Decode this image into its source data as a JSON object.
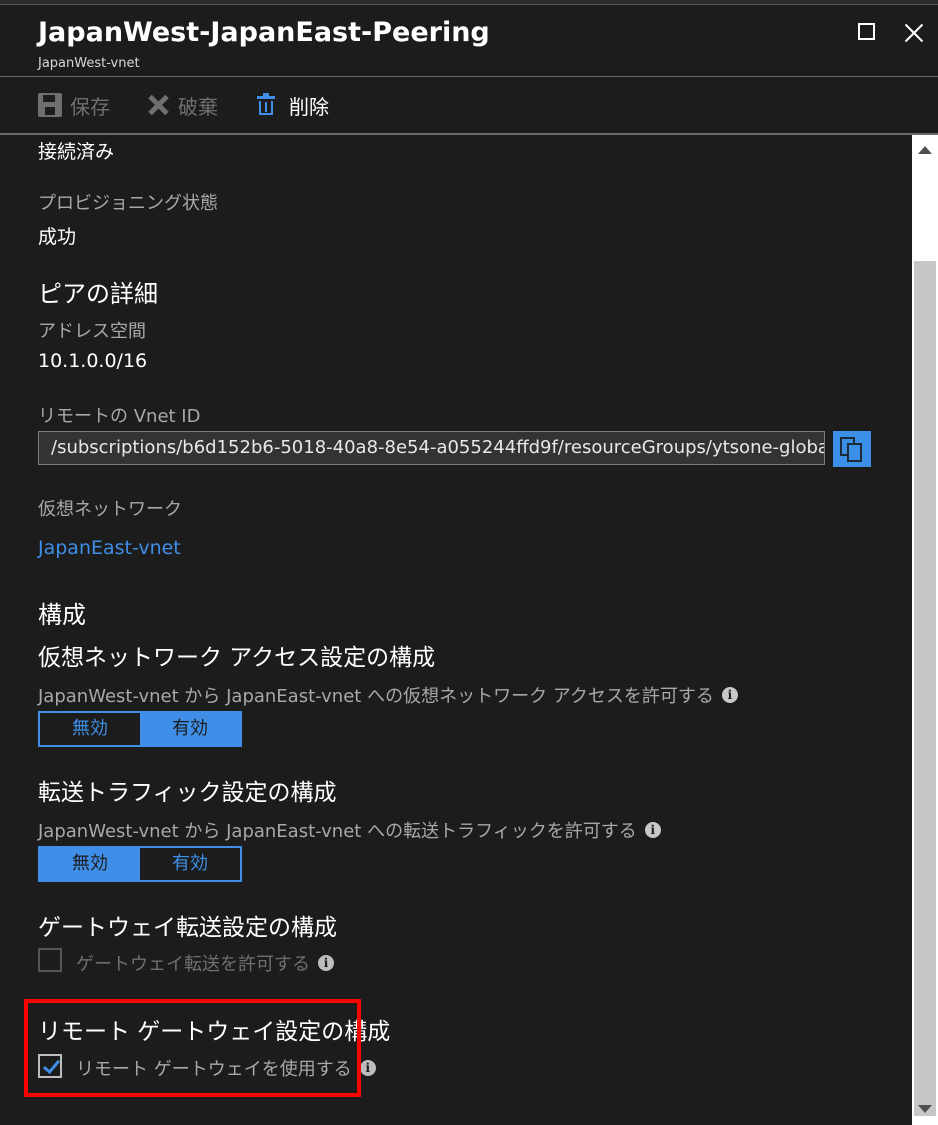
{
  "header": {
    "title": "JapanWest-JapanEast-Peering",
    "subtitle": "JapanWest-vnet"
  },
  "toolbar": {
    "save_label": "保存",
    "discard_label": "破棄",
    "delete_label": "削除"
  },
  "status": {
    "peering_value": "接続済み",
    "provisioning_label": "プロビジョニング状態",
    "provisioning_value": "成功"
  },
  "peer_details": {
    "heading": "ピアの詳細",
    "address_space_label": "アドレス空間",
    "address_space_value": "10.1.0.0/16",
    "remote_vnet_id_label": "リモートの Vnet ID",
    "remote_vnet_id_value": "/subscriptions/b6d152b6-5018-40a8-8e54-a055244ffd9f/resourceGroups/ytsone-globa...",
    "virtual_network_label": "仮想ネットワーク",
    "virtual_network_link": "JapanEast-vnet"
  },
  "configuration": {
    "heading": "構成",
    "vnet_access": {
      "heading": "仮想ネットワーク アクセス設定の構成",
      "description": "JapanWest-vnet から JapanEast-vnet への仮想ネットワーク アクセスを許可する",
      "options": [
        "無効",
        "有効"
      ],
      "selected": "有効"
    },
    "forwarded_traffic": {
      "heading": "転送トラフィック設定の構成",
      "description": "JapanWest-vnet から JapanEast-vnet への転送トラフィックを許可する",
      "options": [
        "無効",
        "有効"
      ],
      "selected": "無効"
    },
    "gateway_transit": {
      "heading": "ゲートウェイ転送設定の構成",
      "checkbox_label": "ゲートウェイ転送を許可する",
      "checked": false,
      "enabled": false
    },
    "remote_gateway": {
      "heading": "リモート ゲートウェイ設定の構成",
      "checkbox_label": "リモート ゲートウェイを使用する",
      "checked": true
    }
  },
  "colors": {
    "background": "#1c1c1c",
    "accent": "#3f8fe8",
    "highlight": "#ff0000",
    "muted_text": "#a8a8a8"
  },
  "icons": {
    "save": "save-icon",
    "discard": "x-icon",
    "delete": "trash-icon",
    "copy": "copy-icon",
    "info": "info-icon",
    "maximize": "maximize-icon",
    "close": "close-icon"
  }
}
